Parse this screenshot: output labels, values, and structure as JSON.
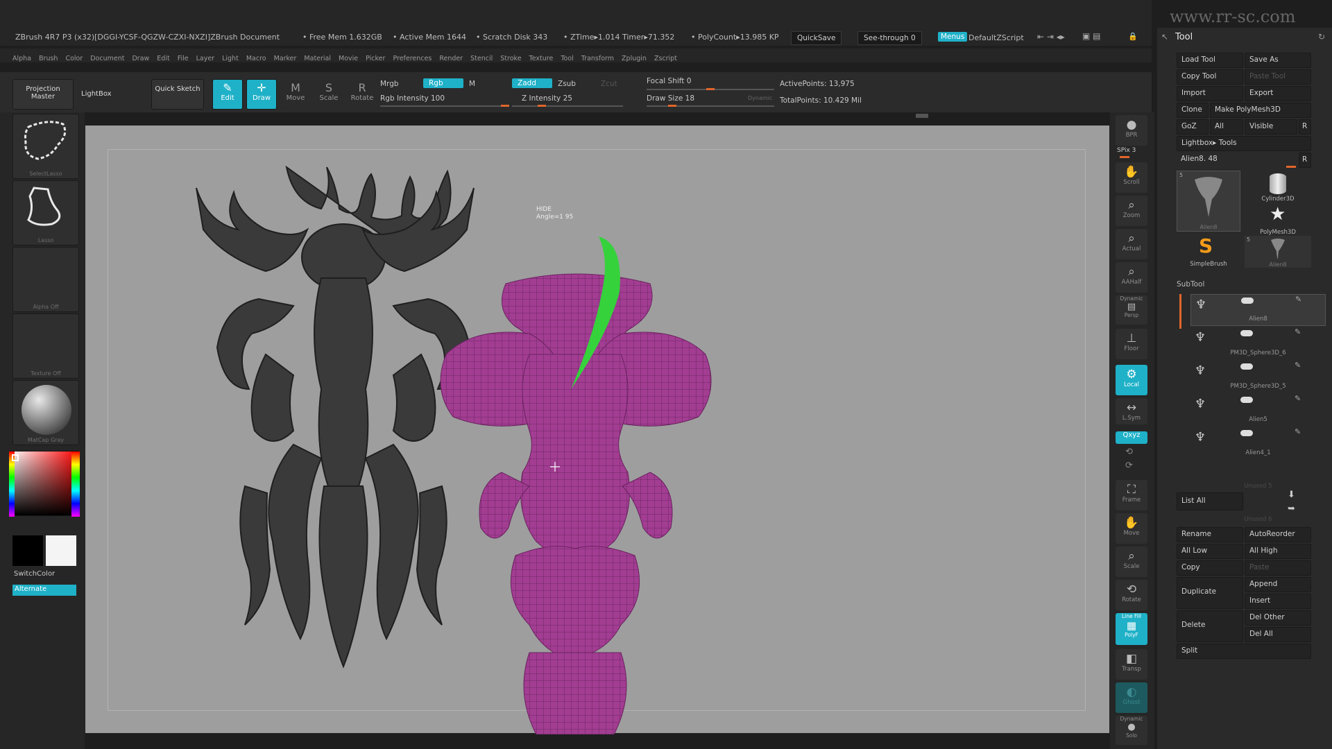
{
  "title": {
    "app": "ZBrush 4R7 P3 (x32)[DGGI-YCSF-QGZW-CZXI-NXZI]ZBrush Document",
    "free_mem": "• Free Mem 1.632GB",
    "active_mem": "• Active Mem 1644",
    "scratch_disk": "• Scratch Disk 343",
    "ztime": "• ZTime▸1.014 Timer▸71.352",
    "polycount": "• PolyCount▸13.985 KP",
    "quicksave": "QuickSave",
    "see_through": "See-through 0",
    "menus": "Menus",
    "default_zscript": "DefaultZScript",
    "watermark": "www.rr-sc.com"
  },
  "menubar": [
    "Alpha",
    "Brush",
    "Color",
    "Document",
    "Draw",
    "Edit",
    "File",
    "Layer",
    "Light",
    "Macro",
    "Marker",
    "Material",
    "Movie",
    "Picker",
    "Preferences",
    "Render",
    "Stencil",
    "Stroke",
    "Texture",
    "Tool",
    "Transform",
    "Zplugin",
    "Zscript"
  ],
  "toolbar": {
    "projection_master": "Projection Master",
    "lightbox": "LightBox",
    "quick_sketch": "Quick Sketch",
    "edit": "Edit",
    "draw": "Draw",
    "move": "Move",
    "scale": "Scale",
    "rotate": "Rotate",
    "mrgb": "Mrgb",
    "rgb": "Rgb",
    "m": "M",
    "rgb_intensity": "Rgb Intensity 100",
    "zadd": "Zadd",
    "zsub": "Zsub",
    "zcut": "Zcut",
    "z_intensity": "Z Intensity 25",
    "focal_shift": "Focal Shift 0",
    "draw_size": "Draw Size 18",
    "dynamic": "Dynamic",
    "active_points": "ActivePoints: 13,975",
    "total_points": "TotalPoints: 10.429 Mil",
    "rgb_intensity_level": 1.0,
    "z_intensity_level": 0.25,
    "focal_shift_level": 0.5,
    "draw_size_level": 0.18
  },
  "leftshelf": {
    "select_lasso": "SelectLasso",
    "lasso": "Lasso",
    "alpha_off": "Alpha Off",
    "texture_off": "Texture Off",
    "matcap_gray": "MatCap Gray",
    "switch_color": "SwitchColor",
    "alternate": "Alternate"
  },
  "canvas": {
    "hint_line1": "HIDE",
    "hint_line2": "Angle=1 95",
    "colors": {
      "model": "#a23d92",
      "canvas": "#9e9e9e",
      "accent": "#1fb1c8"
    }
  },
  "rightshelf": {
    "bpr": "BPR",
    "spix": "SPix 3",
    "scroll": "Scroll",
    "zoom": "Zoom",
    "actual": "Actual",
    "aahalf": "AAHalf",
    "dynamic": "Dynamic",
    "persp": "Persp",
    "floor": "Floor",
    "local": "Local",
    "lsym": "L.Sym",
    "xyz": "Qxyz",
    "frame": "Frame",
    "move": "Move",
    "scale": "Scale",
    "rotate": "Rotate",
    "line_fill": "Line Fill",
    "polyf": "PolyF",
    "transp": "Transp",
    "ghost": "Ghost",
    "solo": "Solo",
    "dynamic2": "Dynamic"
  },
  "palette": {
    "title": "Tool",
    "load_tool": "Load Tool",
    "save_as": "Save As",
    "copy_tool": "Copy Tool",
    "paste_tool": "Paste Tool",
    "import": "Import",
    "export": "Export",
    "clone": "Clone",
    "make_polymesh": "Make PolyMesh3D",
    "goz": "GoZ",
    "all": "All",
    "visible": "Visible",
    "r": "R",
    "lightbox_tools": "Lightbox▸ Tools",
    "alien_slider": "Alien8. 48",
    "thumbs": [
      {
        "name": "Alien8",
        "badge": "5"
      },
      {
        "name": "Cylinder3D",
        "badge": ""
      },
      {
        "name": "PolyMesh3D",
        "badge": ""
      },
      {
        "name": "SimpleBrush",
        "badge": ""
      },
      {
        "name": "Alien8",
        "badge": "5"
      }
    ],
    "subtool_header": "SubTool",
    "subtools": [
      "Alien8",
      "PM3D_Sphere3D_6",
      "PM3D_Sphere3D_5",
      "Alien5",
      "Alien4_1",
      "Unused 5",
      "Unused 6",
      "Unused 7"
    ],
    "list_all": "List All",
    "rename": "Rename",
    "autoreorder": "AutoReorder",
    "all_low": "All Low",
    "all_high": "All High",
    "copy": "Copy",
    "paste": "Paste",
    "duplicate": "Duplicate",
    "append": "Append",
    "insert": "Insert",
    "delete": "Delete",
    "del_other": "Del Other",
    "del_all": "Del All",
    "split": "Split"
  }
}
